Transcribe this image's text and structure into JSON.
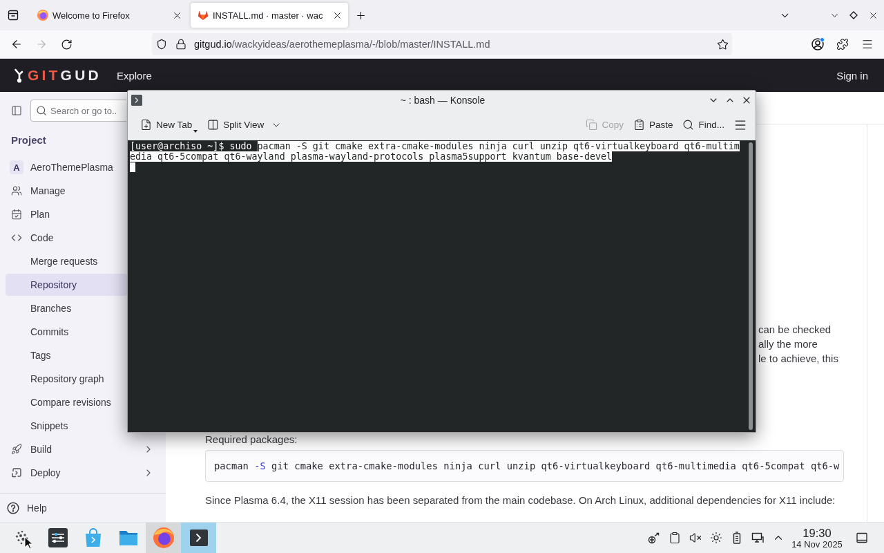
{
  "browser": {
    "tabs": [
      {
        "title": "Welcome to Firefox",
        "selected": false
      },
      {
        "title": "INSTALL.md · master · wac",
        "selected": true
      }
    ],
    "nav_buttons": [
      {
        "kind": "back",
        "disabled": false
      },
      {
        "kind": "forward",
        "disabled": true
      },
      {
        "kind": "reload",
        "disabled": false
      }
    ],
    "address": {
      "host": "gitgud.io",
      "path": "/wackyideas/aerothemeplasma/-/blob/master/INSTALL.md"
    }
  },
  "site_header": {
    "logo_accent": "GIT",
    "logo_rest": "GUD",
    "nav_link": "Explore",
    "sign_in": "Sign in"
  },
  "sidebar": {
    "search": {
      "placeholder": "Search or go to.."
    },
    "section_title": "Project",
    "project": {
      "initial": "A",
      "name": "AeroThemePlasma"
    },
    "items": [
      {
        "kind": "section",
        "label": "Manage",
        "selected": false
      },
      {
        "kind": "section",
        "label": "Plan",
        "selected": false
      },
      {
        "kind": "section",
        "label": "Code",
        "selected": false
      },
      {
        "kind": "link",
        "label": "Merge requests",
        "selected": false
      },
      {
        "kind": "link",
        "label": "Repository",
        "selected": true
      },
      {
        "kind": "link",
        "label": "Branches",
        "selected": false
      },
      {
        "kind": "link",
        "label": "Commits",
        "selected": false
      },
      {
        "kind": "link",
        "label": "Tags",
        "selected": false
      },
      {
        "kind": "link",
        "label": "Repository graph",
        "selected": false
      },
      {
        "kind": "link",
        "label": "Compare revisions",
        "selected": false
      },
      {
        "kind": "link",
        "label": "Snippets",
        "selected": false
      },
      {
        "kind": "flyout",
        "label": "Build",
        "selected": false
      },
      {
        "kind": "flyout",
        "label": "Deploy",
        "selected": false
      }
    ],
    "help": "Help"
  },
  "document": {
    "paragraph_fragment": [
      "can be checked",
      "ally the more",
      "le to achieve, this"
    ],
    "required_label": "Required packages:",
    "code_block": [
      {
        "kind": "command",
        "text": "pacman"
      },
      {
        "kind": "flag",
        "text": "-S"
      },
      {
        "kind": "argument",
        "text": "git cmake extra-cmake-modules ninja curl unzip qt6-virtualkeyboard qt6-multimedia qt6-5compat qt6-w"
      }
    ],
    "x11_note": "Since Plasma 6.4, the X11 session has been separated from the main codebase. On Arch Linux, additional dependencies for X11 include:"
  },
  "konsole": {
    "title": "~ : bash — Konsole",
    "toolbar_left": [
      {
        "kind": "new-tab",
        "label": "New Tab",
        "disabled": false
      },
      {
        "kind": "split-view",
        "label": "Split View",
        "disabled": false
      }
    ],
    "toolbar_right": [
      {
        "kind": "copy",
        "label": "Copy",
        "disabled": true
      },
      {
        "kind": "paste",
        "label": "Paste",
        "disabled": false
      },
      {
        "kind": "find",
        "label": "Find...",
        "disabled": false
      }
    ],
    "rows": [
      {
        "segments": [
          {
            "text": "[user@archiso ~]$",
            "selected": false
          },
          {
            "text": "sudo",
            "selected": false
          },
          {
            "text": "pacman -S git cmake extra-cmake-modules ninja curl unzip qt6-virtualkeyboard qt6-multim",
            "selected": true
          }
        ]
      },
      {
        "segments": [
          {
            "text": "edia qt6-5compat qt6-wayland plasma-wayland-protocols plasma5support kvantum base-devel",
            "selected": true
          }
        ]
      }
    ]
  },
  "taskbar": {
    "tasks": [
      {
        "kind": "launcher",
        "running": false,
        "selected": false
      },
      {
        "kind": "settings",
        "running": false,
        "selected": false
      },
      {
        "kind": "store",
        "running": false,
        "selected": false
      },
      {
        "kind": "files",
        "running": false,
        "selected": false
      },
      {
        "kind": "browser",
        "running": true,
        "selected": false
      },
      {
        "kind": "terminal",
        "running": true,
        "selected": true
      }
    ],
    "clock": {
      "time": "19:30",
      "date": "14 Nov 2025"
    }
  }
}
